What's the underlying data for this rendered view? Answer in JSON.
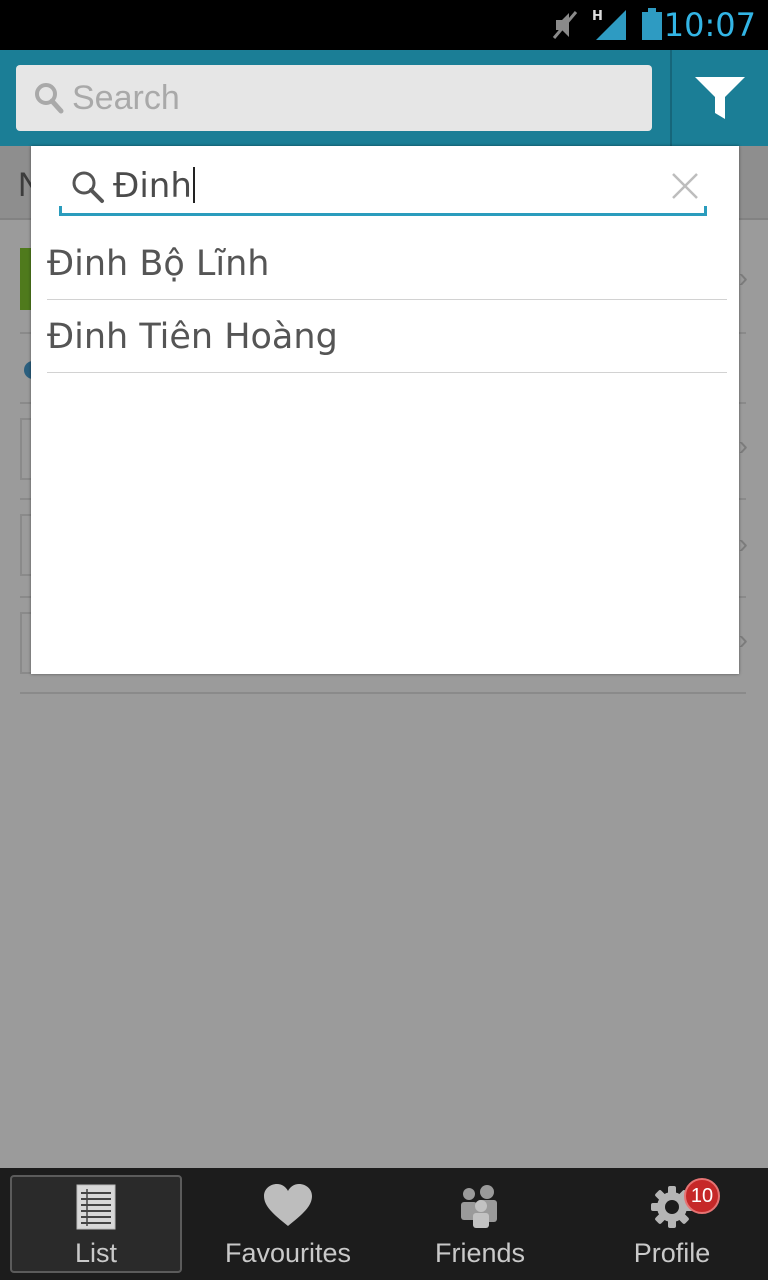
{
  "status_bar": {
    "time": "10:07",
    "icons": [
      "mute-icon",
      "signal-h-icon",
      "battery-icon"
    ]
  },
  "header": {
    "search_placeholder": "Search",
    "filter_icon": "filter-icon"
  },
  "background": {
    "tab_letter": "N"
  },
  "dialog": {
    "query": "Đinh",
    "results": [
      "Đinh Bộ Lĩnh",
      "Đinh Tiên Hoàng"
    ]
  },
  "bottom_nav": {
    "items": [
      {
        "label": "List",
        "icon": "list-icon",
        "active": true
      },
      {
        "label": "Favourites",
        "icon": "heart-icon"
      },
      {
        "label": "Friends",
        "icon": "friends-icon"
      },
      {
        "label": "Profile",
        "icon": "gear-icon",
        "badge": "10"
      }
    ]
  },
  "colors": {
    "accent": "#33b5e5",
    "header": "#1b7e96",
    "badge": "#c62828"
  }
}
